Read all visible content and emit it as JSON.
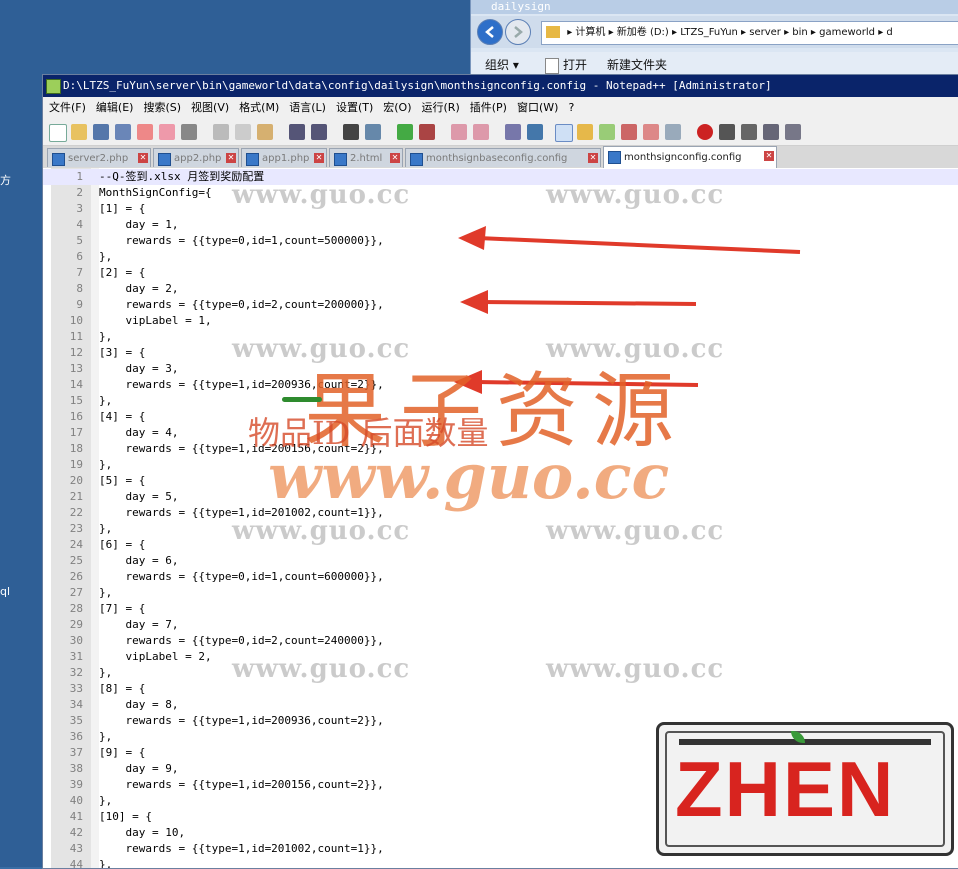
{
  "desktop": {
    "label_top": "方",
    "label_bottom": "ql"
  },
  "explorer": {
    "title": "dailysign",
    "breadcrumb": "▸ 计算机 ▸ 新加卷 (D:) ▸ LTZS_FuYun ▸ server ▸ bin ▸ gameworld ▸ d",
    "organize": "组织 ▾",
    "open": "打开",
    "new_folder": "新建文件夹"
  },
  "npp": {
    "title": "D:\\LTZS_FuYun\\server\\bin\\gameworld\\data\\config\\dailysign\\monthsignconfig.config - Notepad++ [Administrator]",
    "menu": [
      "文件(F)",
      "编辑(E)",
      "搜索(S)",
      "视图(V)",
      "格式(M)",
      "语言(L)",
      "设置(T)",
      "宏(O)",
      "运行(R)",
      "插件(P)",
      "窗口(W)",
      "?"
    ],
    "tabs": [
      {
        "label": "server2.php"
      },
      {
        "label": "app2.php"
      },
      {
        "label": "app1.php"
      },
      {
        "label": "2.html"
      },
      {
        "label": "monthsignbaseconfig.config"
      },
      {
        "label": "monthsignconfig.config"
      }
    ],
    "lines": [
      "--Q-签到.xlsx 月签到奖励配置",
      "MonthSignConfig={",
      "[1] = {",
      "    day = 1,",
      "    rewards = {{type=0,id=1,count=500000}},",
      "},",
      "[2] = {",
      "    day = 2,",
      "    rewards = {{type=0,id=2,count=200000}},",
      "    vipLabel = 1,",
      "},",
      "[3] = {",
      "    day = 3,",
      "    rewards = {{type=1,id=200936,count=2}},",
      "},",
      "[4] = {",
      "    day = 4,",
      "    rewards = {{type=1,id=200156,count=2}},",
      "},",
      "[5] = {",
      "    day = 5,",
      "    rewards = {{type=1,id=201002,count=1}},",
      "},",
      "[6] = {",
      "    day = 6,",
      "    rewards = {{type=0,id=1,count=600000}},",
      "},",
      "[7] = {",
      "    day = 7,",
      "    rewards = {{type=0,id=2,count=240000}},",
      "    vipLabel = 2,",
      "},",
      "[8] = {",
      "    day = 8,",
      "    rewards = {{type=1,id=200936,count=2}},",
      "},",
      "[9] = {",
      "    day = 9,",
      "    rewards = {{type=1,id=200156,count=2}},",
      "},",
      "[10] = {",
      "    day = 10,",
      "    rewards = {{type=1,id=201002,count=1}},",
      "},"
    ]
  },
  "overlay": {
    "watermark": "www.guo.cc",
    "big_title": "果子资源",
    "annotation": "物品ID  后面数量",
    "big_url": "www.guo.cc",
    "stamp": "ZHEN"
  }
}
